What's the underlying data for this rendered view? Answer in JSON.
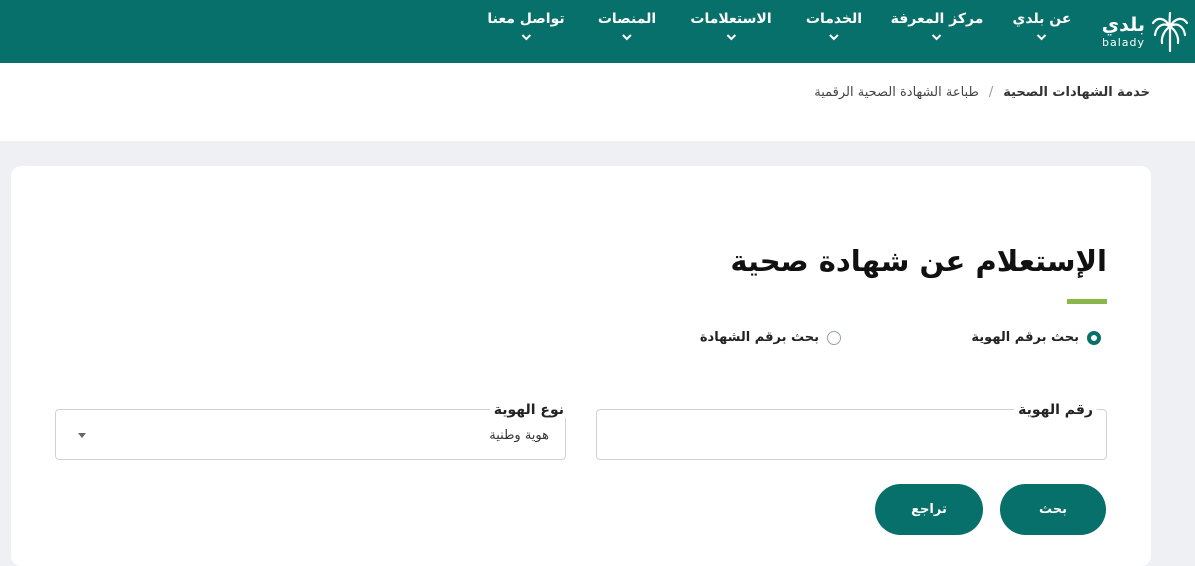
{
  "brand": {
    "name_ar": "بلدي",
    "name_en": "balady",
    "color": "#07706a"
  },
  "nav": {
    "items": [
      {
        "label": "عن بلدي"
      },
      {
        "label": "مركز المعرفة"
      },
      {
        "label": "الخدمات"
      },
      {
        "label": "الاستعلامات"
      },
      {
        "label": "المنصات"
      },
      {
        "label": "تواصل معنا"
      }
    ]
  },
  "breadcrumb": {
    "parent": "خدمة الشهادات الصحية",
    "separator": "/",
    "current": "طباعة الشهادة الصحية الرقمية"
  },
  "form": {
    "title": "الإستعلام عن شهادة صحية",
    "accent_color": "#8ab64a",
    "search_options": [
      {
        "label": "بحث برقم الهوية",
        "checked": true
      },
      {
        "label": "بحث برقم الشهادة",
        "checked": false
      }
    ],
    "id_number": {
      "label": "رقم الهوية",
      "value": ""
    },
    "id_type": {
      "label": "نوع الهوية",
      "selected": "هوية وطنية"
    },
    "buttons": {
      "search": "بحث",
      "back": "تراجع"
    }
  }
}
